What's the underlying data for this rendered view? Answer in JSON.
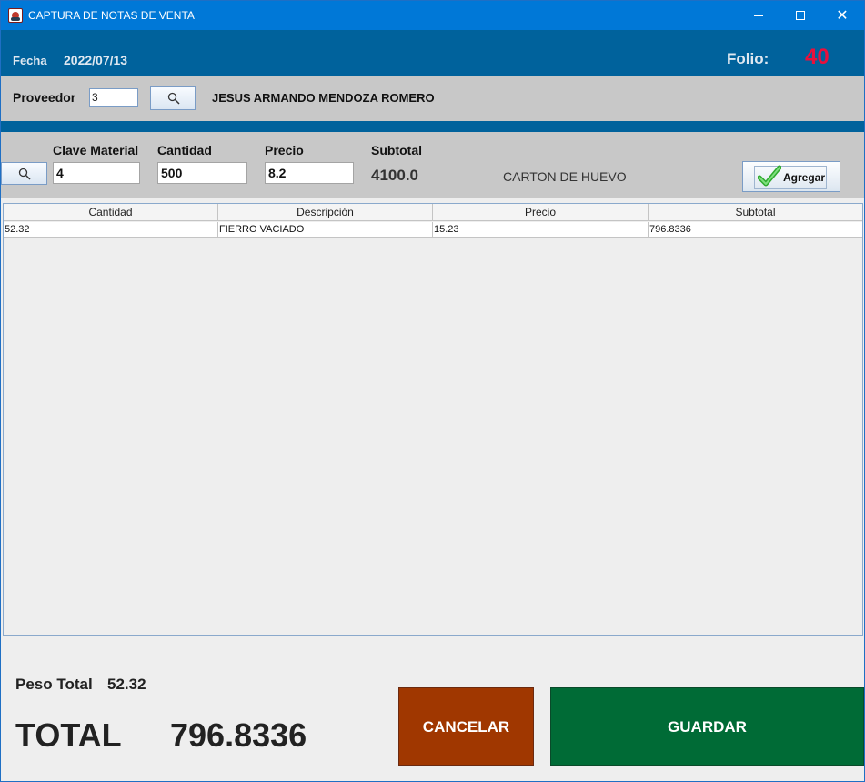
{
  "window": {
    "title": "CAPTURA DE NOTAS DE VENTA",
    "controls": {
      "minimize": "minimize",
      "maximize": "maximize",
      "close": "✕"
    }
  },
  "header": {
    "fecha_label": "Fecha",
    "fecha_value": "2022/07/13",
    "folio_label": "Folio:",
    "folio_value": "40"
  },
  "proveedor": {
    "label": "Proveedor",
    "id_value": "3",
    "name": "JESUS ARMANDO MENDOZA ROMERO"
  },
  "material": {
    "clave_label": "Clave Material",
    "clave_value": "4",
    "cantidad_label": "Cantidad",
    "cantidad_value": "500",
    "precio_label": "Precio",
    "precio_value": "8.2",
    "subtotal_label": "Subtotal",
    "subtotal_value": "4100.0",
    "description": "CARTON DE HUEVO",
    "add_button_label": "Agregar"
  },
  "table": {
    "columns": [
      "Cantidad",
      "Descripción",
      "Precio",
      "Subtotal"
    ],
    "rows": [
      [
        "52.32",
        "FIERRO VACIADO",
        "15.23",
        "796.8336"
      ]
    ]
  },
  "footer": {
    "peso_label": "Peso Total",
    "peso_value": "52.32",
    "total_label": "TOTAL",
    "total_value": "796.8336",
    "cancel_label": "CANCELAR",
    "save_label": "GUARDAR"
  },
  "colors": {
    "titlebar": "#0078d7",
    "header_band": "#00629c",
    "folio": "#e8103c",
    "cancel": "#a03700",
    "save": "#006b36"
  }
}
